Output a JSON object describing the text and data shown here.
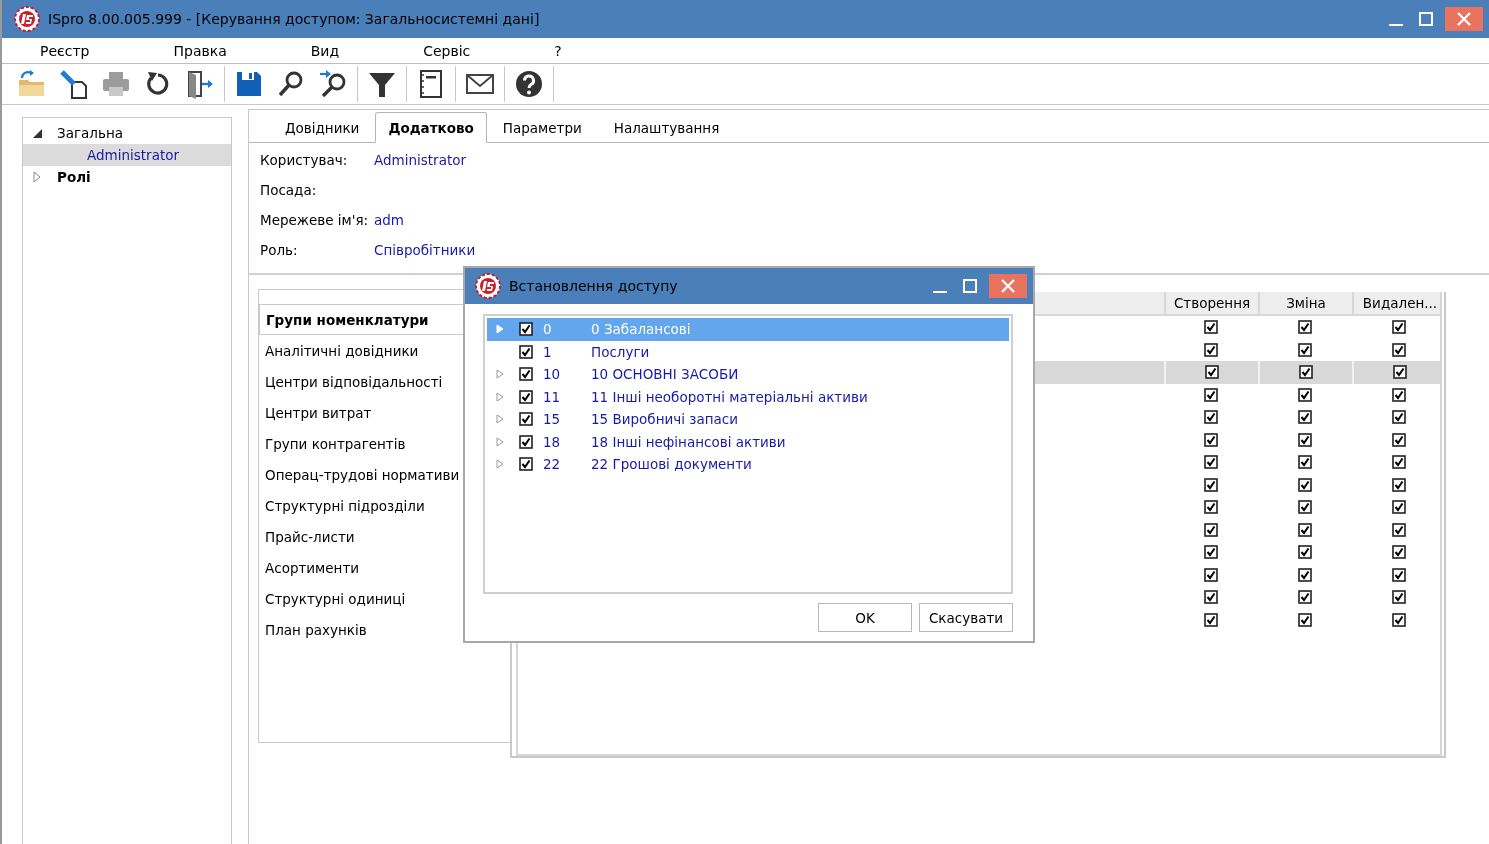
{
  "window": {
    "title": "ISpro 8.00.005.999 - [Керування доступом:  Загальносистемні дані]"
  },
  "menu": [
    "Реєстр",
    "Правка",
    "Вид",
    "Сервіс",
    "?"
  ],
  "sidebar": {
    "items": [
      {
        "label": "Загальна",
        "expanded": true,
        "selected": false,
        "children": [
          {
            "label": "Administrator",
            "selected": true
          }
        ]
      },
      {
        "label": "Ролі",
        "expanded": false,
        "selected": false
      }
    ]
  },
  "tabs": [
    {
      "label": "Довідники",
      "selected": false
    },
    {
      "label": "Додатково",
      "selected": true
    },
    {
      "label": "Параметри",
      "selected": false
    },
    {
      "label": "Налаштування",
      "selected": false
    }
  ],
  "fields": [
    {
      "label": "Користувач:",
      "value": "Administrator"
    },
    {
      "label": "Посада:"
    },
    {
      "label": "Мережеве ім'я:",
      "value": "adm"
    },
    {
      "label": "Роль:",
      "value": "Співробітники"
    }
  ],
  "groups": [
    {
      "label": "Групи номенклатури",
      "selected": true
    },
    {
      "label": "Аналітичні довідники",
      "selected": false
    },
    {
      "label": "Центри відповідальності",
      "selected": false
    },
    {
      "label": "Центри витрат",
      "selected": false
    },
    {
      "label": "Групи контрагентів",
      "selected": false
    },
    {
      "label": "Операц-трудові нормативи",
      "selected": false
    },
    {
      "label": "Структурні підрозділи",
      "selected": false
    },
    {
      "label": "Прайс-листи",
      "selected": false
    },
    {
      "label": "Асортименти",
      "selected": false
    },
    {
      "label": "Структурні одиниці",
      "selected": false
    },
    {
      "label": "План рахунків",
      "selected": false
    }
  ],
  "table": {
    "columns": [
      "Створення",
      "Зміна",
      "Видален..."
    ],
    "rows": [
      {
        "selected": false,
        "cells": [
          true,
          true,
          true
        ]
      },
      {
        "selected": false,
        "cells": [
          true,
          true,
          true
        ]
      },
      {
        "selected": true,
        "cells": [
          true,
          true,
          true
        ]
      },
      {
        "selected": false,
        "cells": [
          true,
          true,
          true
        ]
      },
      {
        "selected": false,
        "cells": [
          true,
          true,
          true
        ]
      },
      {
        "selected": false,
        "cells": [
          true,
          true,
          true
        ]
      },
      {
        "selected": false,
        "cells": [
          true,
          true,
          true
        ]
      },
      {
        "selected": false,
        "cells": [
          true,
          true,
          true
        ]
      },
      {
        "selected": false,
        "cells": [
          true,
          true,
          true
        ]
      },
      {
        "selected": false,
        "cells": [
          true,
          true,
          true
        ]
      },
      {
        "selected": false,
        "cells": [
          true,
          true,
          true
        ]
      },
      {
        "selected": false,
        "cells": [
          true,
          true,
          true
        ]
      },
      {
        "selected": false,
        "cells": [
          true,
          true,
          true
        ]
      },
      {
        "selected": false,
        "cells": [
          true,
          true,
          true
        ]
      }
    ]
  },
  "dialog": {
    "title": "Встановлення доступу",
    "items": [
      {
        "code": "0",
        "name": "0 Забалансові",
        "expandable": true,
        "checked": true,
        "selected": true
      },
      {
        "code": "1",
        "name": "Послуги",
        "expandable": false,
        "checked": true,
        "selected": false
      },
      {
        "code": "10",
        "name": "10 ОСНОВНІ ЗАСОБИ",
        "expandable": true,
        "checked": true,
        "selected": false
      },
      {
        "code": "11",
        "name": "11 Інші необоротні матеріальні активи",
        "expandable": true,
        "checked": true,
        "selected": false
      },
      {
        "code": "15",
        "name": "15 Виробничі запаси",
        "expandable": true,
        "checked": true,
        "selected": false
      },
      {
        "code": "18",
        "name": "18 Інші нефінансові активи",
        "expandable": true,
        "checked": true,
        "selected": false
      },
      {
        "code": "22",
        "name": "22 Грошові документи",
        "expandable": true,
        "checked": true,
        "selected": false
      }
    ],
    "buttons": [
      "OK",
      "Скасувати"
    ]
  }
}
